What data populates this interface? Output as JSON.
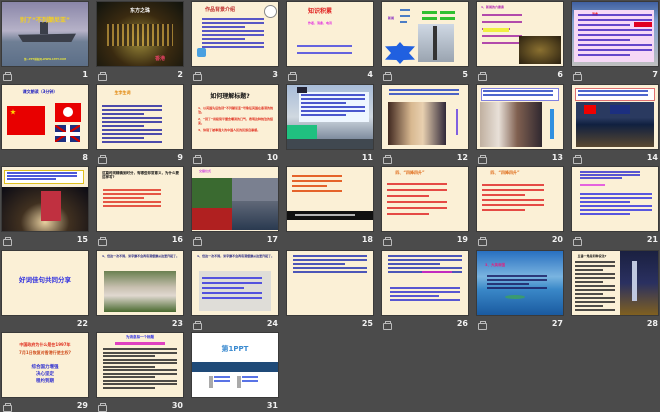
{
  "slides": [
    {
      "number": "1",
      "icon": true,
      "title": "别了“不列颠尼亚”",
      "sub": "第一PPT模板网-WWW.1PPT.COM"
    },
    {
      "number": "2",
      "icon": true,
      "title": "东方之珠",
      "sub": "香港"
    },
    {
      "number": "3",
      "icon": true,
      "title": "作品背景介绍"
    },
    {
      "number": "4",
      "icon": true,
      "title": "知识积累",
      "sub": "作者、消息、电讯"
    },
    {
      "number": "5",
      "icon": true,
      "title": "新闻",
      "sub": "导语"
    },
    {
      "number": "6",
      "icon": true,
      "title": "1、新闻的六要素"
    },
    {
      "number": "7",
      "icon": true,
      "title": "消息"
    },
    {
      "number": "8",
      "icon": false,
      "title": "课文朗读（3分钟）"
    },
    {
      "number": "9",
      "icon": true,
      "title": "生字生词"
    },
    {
      "number": "10",
      "icon": true,
      "title": "如何理解标题?",
      "lines": [
        "1、以英国先后告别“不列颠尼亚”号象征英国在香港的统治。",
        "2、“别了”用极简平缓含嘲讽的口气，表明这种统治的结束。",
        "3、体现了被奉强大的中国人民的民族自豪感。"
      ]
    },
    {
      "number": "11",
      "icon": false,
      "title": ""
    },
    {
      "number": "12",
      "icon": true,
      "title": ""
    },
    {
      "number": "13",
      "icon": true,
      "title": ""
    },
    {
      "number": "14",
      "icon": true,
      "title": ""
    },
    {
      "number": "15",
      "icon": true,
      "title": ""
    },
    {
      "number": "16",
      "icon": true,
      "title": "这篇时间精确到时分，有哪些非常意义，为什么要这样写?"
    },
    {
      "number": "17",
      "icon": true,
      "title": "交接仪式"
    },
    {
      "number": "18",
      "icon": false,
      "title": ""
    },
    {
      "number": "19",
      "icon": true,
      "title": "四、“四降四升”"
    },
    {
      "number": "20",
      "icon": true,
      "title": "四、“四降四升”"
    },
    {
      "number": "21",
      "icon": true,
      "title": ""
    },
    {
      "number": "22",
      "icon": false,
      "title": "好词佳句共同分享"
    },
    {
      "number": "23",
      "icon": false,
      "title": "1、但这一次不同，米字旗不会再有港督旗从这里升起了。"
    },
    {
      "number": "24",
      "icon": true,
      "title": "1、但这一次不同，米字旗不会再有港督旗从这里升起了。"
    },
    {
      "number": "25",
      "icon": false,
      "title": ""
    },
    {
      "number": "26",
      "icon": true,
      "title": ""
    },
    {
      "number": "27",
      "icon": true,
      "title": "3、大英帝国"
    },
    {
      "number": "28",
      "icon": false,
      "title": "五香一角是何种说法?"
    },
    {
      "number": "29",
      "icon": true,
      "title": "中国政府为什么是在1997年",
      "title2": "7月1日恢复对香港行使主权?",
      "lines": [
        "综合国力增强",
        "决心坚定",
        "租约到期"
      ]
    },
    {
      "number": "30",
      "icon": true,
      "title": "为消息拟一个标题"
    },
    {
      "number": "31",
      "icon": false,
      "title": "第1PPT"
    }
  ]
}
